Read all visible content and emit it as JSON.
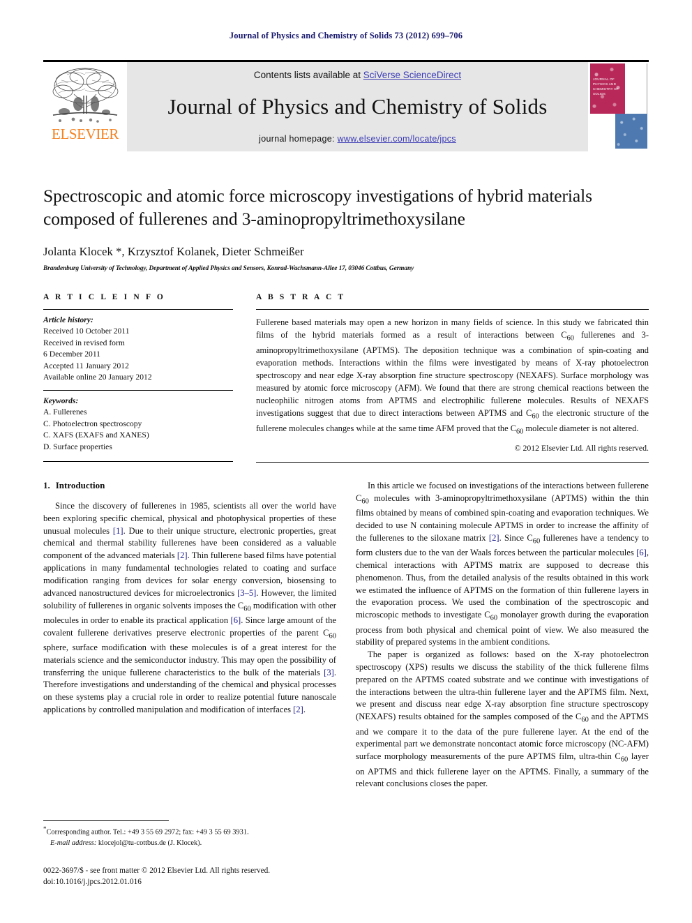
{
  "running_head": "Journal of Physics and Chemistry of Solids 73 (2012) 699–706",
  "header": {
    "contents_prefix": "Contents lists available at ",
    "sciencedirect_link": "SciVerse ScienceDirect",
    "journal_title": "Journal of Physics and Chemistry of Solids",
    "homepage_prefix": "journal homepage: ",
    "homepage_url": "www.elsevier.com/locate/jpcs",
    "publisher_wordmark": "ELSEVIER",
    "publisher_color": "#F58220",
    "link_color": "#3b3bb5",
    "band_background": "#e6e6e6",
    "cover_title_lines": "JOURNAL OF PHYSICS AND CHEMISTRY OF SOLIDS",
    "cover_red": "#b8295a",
    "cover_blue": "#4d79b0"
  },
  "article": {
    "title": "Spectroscopic and atomic force microscopy investigations of hybrid materials composed of fullerenes and 3-aminopropyltrimethoxysilane",
    "authors": "Jolanta Klocek *, Krzysztof Kolanek, Dieter Schmeißer",
    "affiliation": "Brandenburg University of Technology, Department of Applied Physics and Sensors, Konrad-Wachsmann-Allee 17, 03046 Cottbus, Germany"
  },
  "article_info": {
    "heading": "A R T I C L E  I N F O",
    "history_label": "Article history:",
    "history": [
      "Received 10 October 2011",
      "Received in revised form",
      "6 December 2011",
      "Accepted 11 January 2012",
      "Available online 20 January 2012"
    ],
    "keywords_label": "Keywords:",
    "keywords": [
      "A. Fullerenes",
      "C. Photoelectron spectroscopy",
      "C. XAFS (EXAFS and XANES)",
      "D. Surface properties"
    ]
  },
  "abstract": {
    "heading": "A B S T R A C T",
    "text_part1": "Fullerene based materials may open a new horizon in many fields of science. In this study we fabricated thin films of the hybrid materials formed as a result of interactions between C",
    "sub1": "60",
    "text_part2": " fullerenes and 3-aminopropyltrimethoxysilane (APTMS). The deposition technique was a combination of spin-coating and evaporation methods. Interactions within the films were investigated by means of X-ray photoelectron spectroscopy and near edge X-ray absorption fine structure spectroscopy (NEXAFS). Surface morphology was measured by atomic force microscopy (AFM). We found that there are strong chemical reactions between the nucleophilic nitrogen atoms from APTMS and electrophilic fullerene molecules. Results of NEXAFS investigations suggest that due to direct interactions between APTMS and C",
    "sub2": "60",
    "text_part3": " the electronic structure of the fullerene molecules changes while at the same time AFM proved that the C",
    "sub3": "60",
    "text_part4": " molecule diameter is not altered.",
    "copyright": "© 2012 Elsevier Ltd. All rights reserved."
  },
  "introduction": {
    "number": "1.",
    "heading": "Introduction",
    "p1_a": "Since the discovery of fullerenes in 1985, scientists all over the world have been exploring specific chemical, physical and photophysical properties of these unusual molecules ",
    "p1_r1": "[1]",
    "p1_b": ". Due to their unique structure, electronic properties, great chemical and thermal stability fullerenes have been considered as a valuable component of the advanced materials ",
    "p1_r2": "[2]",
    "p1_c": ". Thin fullerene based films have potential applications in many fundamental technologies related to coating and surface modification ranging from devices for solar energy conversion, biosensing to advanced nanostructured devices for microelectronics ",
    "p1_r3": "[3–5]",
    "p1_d": ". However, the limited solubility of fullerenes in organic solvents imposes the C",
    "p1_sub1": "60",
    "p1_e": " modification with other molecules in order to enable its practical application ",
    "p1_r4": "[6]",
    "p1_f": ". Since large amount of the covalent fullerene derivatives preserve electronic properties of the parent C",
    "p1_sub2": "60",
    "p1_g": " sphere, surface modification with these molecules is of a great interest for the materials science and the semiconductor industry. This may open the possibility of transferring the unique fullerene characteristics to the bulk of the materials ",
    "p1_r5": "[3]",
    "p1_h": ". Therefore investigations and understanding of the chemical and physical processes on these systems play a crucial role in order to realize potential future nanoscale applications by controlled manipulation and modification of interfaces ",
    "p1_r6": "[2]",
    "p1_i": ".",
    "p2_a": "In this article we focused on investigations of the interactions between fullerene C",
    "p2_sub1": "60",
    "p2_b": " molecules with 3-aminopropyltrimethoxysilane (APTMS) within the thin films obtained by means of combined spin-coating and evaporation techniques. We decided to use N containing molecule APTMS in order to increase the affinity of the fullerenes to the siloxane matrix ",
    "p2_r1": "[2]",
    "p2_c": ". Since C",
    "p2_sub2": "60",
    "p2_d": " fullerenes have a tendency to form clusters due to the van der Waals forces between the particular molecules ",
    "p2_r2": "[6]",
    "p2_e": ", chemical interactions with APTMS matrix are supposed to decrease this phenomenon. Thus, from the detailed analysis of the results obtained in this work we estimated the influence of APTMS on the formation of thin fullerene layers in the evaporation process. We used the combination of the spectroscopic and microscopic methods to investigate C",
    "p2_sub3": "60",
    "p2_f": " monolayer growth during the evaporation process from both physical and chemical point of view. We also measured the stability of prepared systems in the ambient conditions.",
    "p3_a": "The paper is organized as follows: based on the X-ray photoelectron spectroscopy (XPS) results we discuss the stability of the thick fullerene films prepared on the APTMS coated substrate and we continue with investigations of the interactions between the ultra-thin fullerene layer and the APTMS film. Next, we present and discuss near edge X-ray absorption fine structure spectroscopy (NEXAFS) results obtained for the samples composed of the C",
    "p3_sub1": "60",
    "p3_b": " and the APTMS and we compare it to the data of the pure fullerene layer. At the end of the experimental part we demonstrate noncontact atomic force microscopy (NC-AFM) surface morphology measurements of the pure APTMS film, ultra-thin C",
    "p3_sub2": "60",
    "p3_c": " layer on APTMS and thick fullerene layer on the APTMS. Finally, a summary of the relevant conclusions closes the paper."
  },
  "footer": {
    "corresponding_marker": "*",
    "corresponding": "Corresponding author. Tel.: +49 3 55 69 2972; fax: +49 3 55 69 3931.",
    "email_label": "E-mail address:",
    "email": " klocejol@tu-cottbus.de (J. Klocek).",
    "imprint_line1": "0022-3697/$ - see front matter © 2012 Elsevier Ltd. All rights reserved.",
    "imprint_line2": "doi:10.1016/j.jpcs.2012.01.016"
  }
}
